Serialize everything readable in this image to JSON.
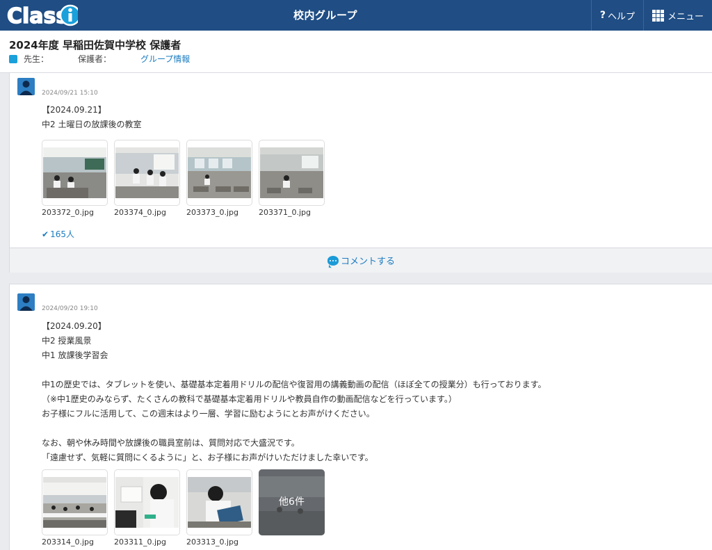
{
  "topbar": {
    "logo_text": "Classi",
    "title": "校内グループ",
    "help_label": "ヘルプ",
    "menu_label": "メニュー"
  },
  "group": {
    "name": "2024年度 早稲田佐賀中学校 保護者",
    "teacher_label": "先生：",
    "parent_label": "保護者：",
    "info_link": "グループ情報"
  },
  "posts": [
    {
      "timestamp": "2024/09/21 15:10",
      "lines": [
        "【2024.09.21】",
        "中2 土曜日の放課後の教室"
      ],
      "images": [
        "203372_0.jpg",
        "203374_0.jpg",
        "203373_0.jpg",
        "203371_0.jpg"
      ],
      "read_count": "165人",
      "comment_label": "コメントする"
    },
    {
      "timestamp": "2024/09/20 19:10",
      "lines": [
        "【2024.09.20】",
        "中2 授業風景",
        "中1 放課後学習会",
        "",
        "中1の歴史では、タブレットを使い、基礎基本定着用ドリルの配信や復習用の講義動画の配信（ほぼ全ての授業分）も行っております。",
        "（※中1歴史のみならず、たくさんの教科で基礎基本定着用ドリルや教員自作の動画配信などを行っています。）",
        "お子様にフルに活用して、この週末はより一層、学習に励むようにとお声がけください。",
        "",
        "なお、朝や休み時間や放課後の職員室前は、質問対応で大盛況です。",
        "「遠慮せず、気軽に質問にくるように」と、お子様にお声がけいただけました幸いです。"
      ],
      "images": [
        "203314_0.jpg",
        "203311_0.jpg",
        "203313_0.jpg"
      ],
      "more_label": "他6件"
    }
  ],
  "colors": {
    "header_bg": "#1f4d84",
    "accent": "#1a7cc1",
    "avatar": "#2d7ec2"
  }
}
